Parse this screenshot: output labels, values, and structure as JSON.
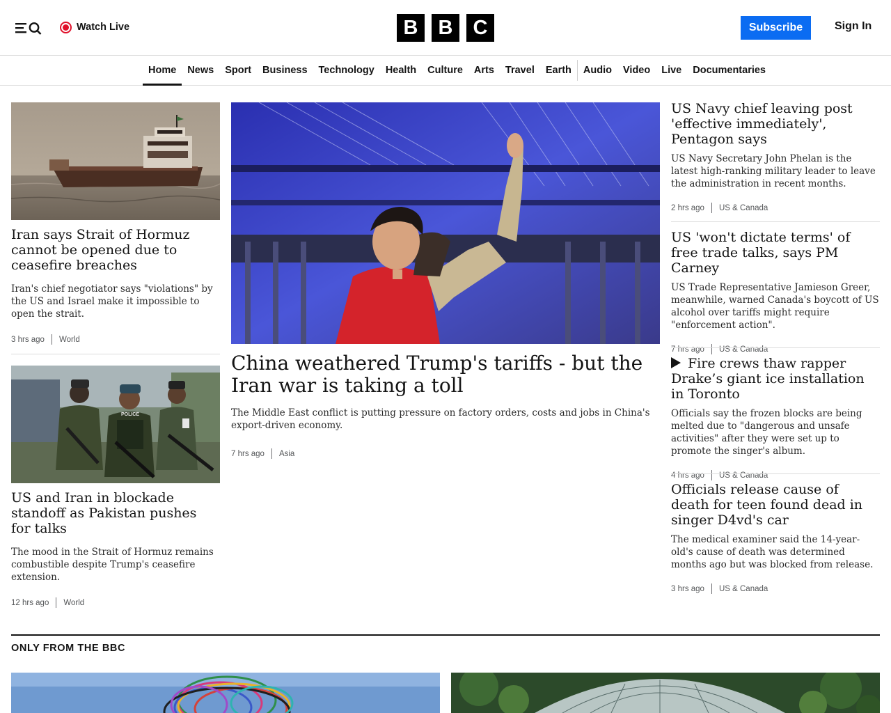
{
  "header": {
    "watch_live": "Watch Live",
    "logo_letters": [
      "B",
      "B",
      "C"
    ],
    "subscribe": "Subscribe",
    "sign_in": "Sign In",
    "accent": "#0b6cf2",
    "live_color": "#e0102a"
  },
  "nav": {
    "items": [
      {
        "label": "Home",
        "active": true
      },
      {
        "label": "News"
      },
      {
        "label": "Sport"
      },
      {
        "label": "Business"
      },
      {
        "label": "Technology"
      },
      {
        "label": "Health"
      },
      {
        "label": "Culture"
      },
      {
        "label": "Arts"
      },
      {
        "label": "Travel"
      },
      {
        "label": "Earth"
      },
      {
        "label": "Audio"
      },
      {
        "label": "Video"
      },
      {
        "label": "Live"
      },
      {
        "label": "Documentaries"
      }
    ]
  },
  "left_stories": [
    {
      "headline": "Iran says Strait of Hormuz cannot be opened due to ceasefire breaches",
      "summary": "Iran's chief negotiator says \"violations\" by the US and Israel make it impossible to open the strait.",
      "time": "3 hrs ago",
      "section": "World"
    },
    {
      "headline": "US and Iran in blockade standoff as Pakistan pushes for talks",
      "summary": "The mood in the Strait of Hormuz remains combustible despite Trump's ceasefire extension.",
      "time": "12 hrs ago",
      "section": "World",
      "image_text": "POLICE"
    }
  ],
  "main_story": {
    "headline": "China weathered Trump's tariffs - but the Iran war is taking a toll",
    "summary": "The Middle East conflict is putting pressure on factory orders, costs and jobs in China's export-driven economy.",
    "time": "7 hrs ago",
    "section": "Asia"
  },
  "right_stories": [
    {
      "headline": "US Navy chief leaving post 'effective immediately', Pentagon says",
      "summary": "US Navy Secretary John Phelan is the latest high-ranking military leader to leave the administration in recent months.",
      "time": "2 hrs ago",
      "section": "US & Canada"
    },
    {
      "headline": "US 'won't dictate terms' of free trade talks, says PM Carney",
      "summary": "US Trade Representative Jamieson Greer, meanwhile, warned Canada's boycott of US alcohol over tariffs might require \"enforcement action\".",
      "time": "7 hrs ago",
      "section": "US & Canada"
    },
    {
      "headline": "Fire crews thaw rapper Drake’s giant ice installation in Toronto",
      "summary": "Officials say the frozen blocks are being melted due to \"dangerous and unsafe activities\" after they were set up to promote the singer's album.",
      "time": "4 hrs ago",
      "section": "US & Canada",
      "video": true
    },
    {
      "headline": "Officials release cause of death for teen found dead in singer D4vd's car",
      "summary": "The medical examiner said the 14-year-old's cause of death was determined months ago but was blocked from release.",
      "time": "3 hrs ago",
      "section": "US & Canada"
    }
  ],
  "only_from_bbc": {
    "title": "ONLY FROM THE BBC"
  }
}
